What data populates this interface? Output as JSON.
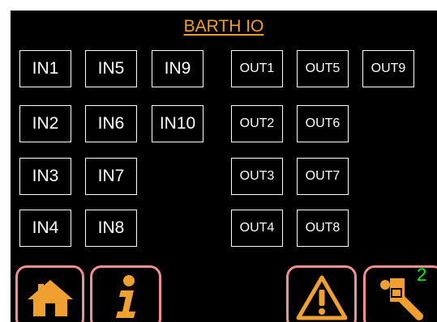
{
  "title": "BARTH IO",
  "inputs": [
    {
      "label": "IN1",
      "col": 0,
      "row": 0
    },
    {
      "label": "IN5",
      "col": 1,
      "row": 0
    },
    {
      "label": "IN9",
      "col": 2,
      "row": 0
    },
    {
      "label": "IN2",
      "col": 0,
      "row": 1
    },
    {
      "label": "IN6",
      "col": 1,
      "row": 1
    },
    {
      "label": "IN10",
      "col": 2,
      "row": 1
    },
    {
      "label": "IN3",
      "col": 0,
      "row": 2
    },
    {
      "label": "IN7",
      "col": 1,
      "row": 2
    },
    {
      "label": "IN4",
      "col": 0,
      "row": 3
    },
    {
      "label": "IN8",
      "col": 1,
      "row": 3
    }
  ],
  "outputs": [
    {
      "label": "OUT1",
      "col": 0,
      "row": 0
    },
    {
      "label": "OUT5",
      "col": 1,
      "row": 0
    },
    {
      "label": "OUT9",
      "col": 2,
      "row": 0
    },
    {
      "label": "OUT2",
      "col": 0,
      "row": 1
    },
    {
      "label": "OUT6",
      "col": 1,
      "row": 1
    },
    {
      "label": "OUT3",
      "col": 0,
      "row": 2
    },
    {
      "label": "OUT7",
      "col": 1,
      "row": 2
    },
    {
      "label": "OUT4",
      "col": 0,
      "row": 3
    },
    {
      "label": "OUT8",
      "col": 1,
      "row": 3
    }
  ],
  "nav": {
    "home_icon": "home-icon",
    "info_icon": "info-icon",
    "warning_icon": "warning-icon",
    "settings_icon": "settings-icon",
    "badge": "2"
  },
  "colors": {
    "accent": "#f0a030",
    "frame": "#ef8f8f",
    "badge": "#00ff00",
    "background": "#000000"
  }
}
